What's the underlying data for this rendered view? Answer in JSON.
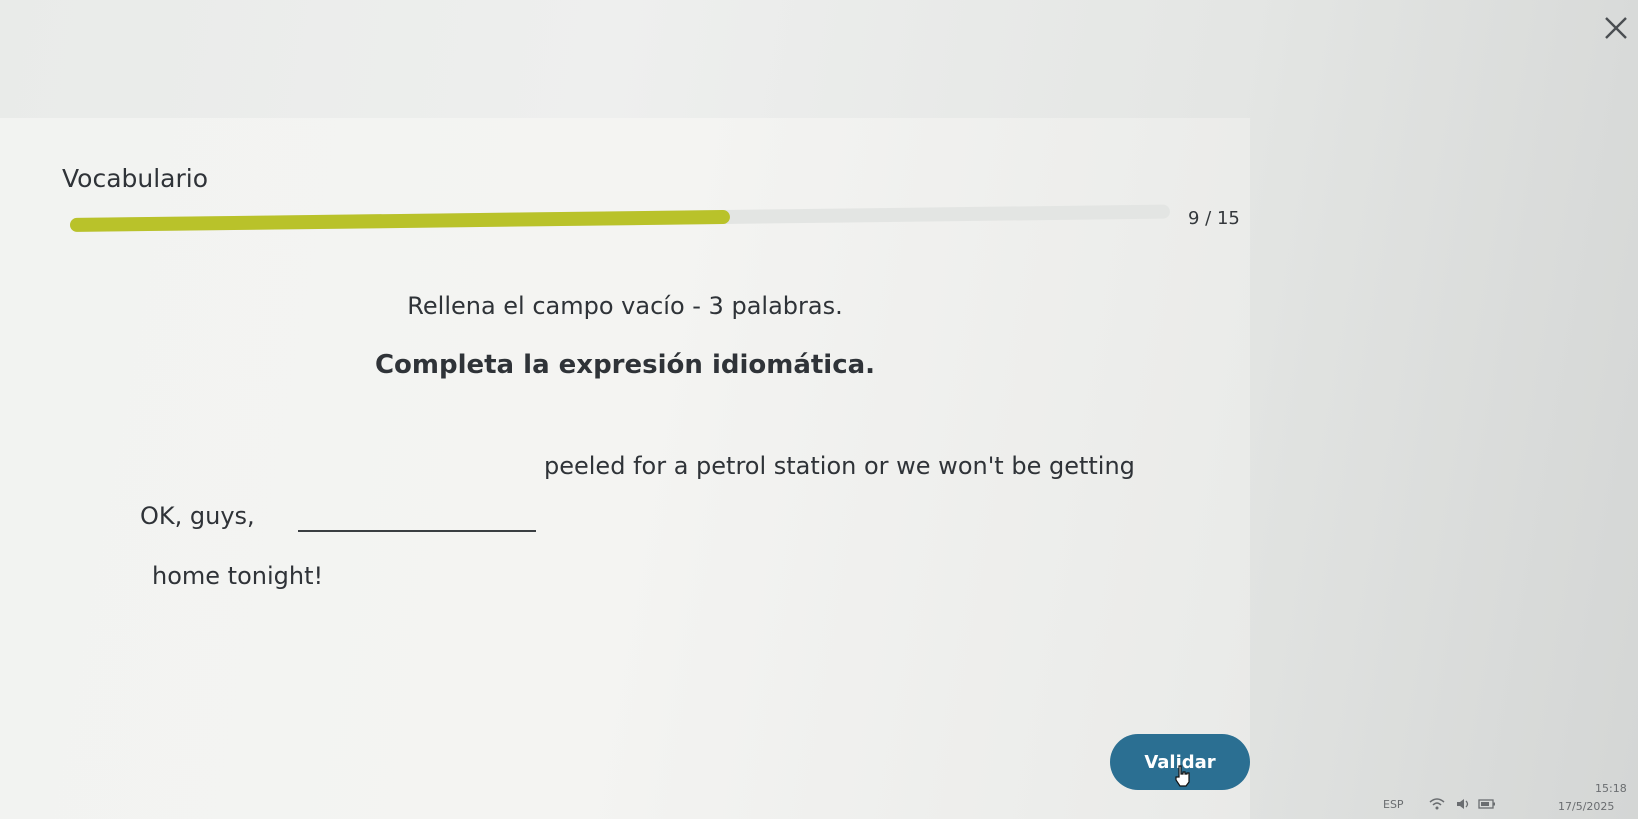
{
  "window": {
    "close_icon": "close-icon"
  },
  "header": {
    "title": "Vocabulario"
  },
  "progress": {
    "current": 9,
    "total": 15,
    "label": "9 / 15",
    "fill_color": "#b9c22a",
    "track_color": "#e3e5e3"
  },
  "exercise": {
    "instruction": "Rellena el campo vacío - 3 palabras.",
    "subtitle": "Completa la expresión idiomática.",
    "sentence_start": "OK, guys,",
    "answer_value": "",
    "sentence_middle": "peeled for a petrol station or we won't be getting",
    "sentence_end": "home tonight!"
  },
  "actions": {
    "validate_label": "Validar",
    "validate_color": "#2b6f92"
  },
  "taskbar": {
    "language": "ESP",
    "time": "15:18",
    "date": "17/5/2025",
    "icons": [
      "wifi-icon",
      "volume-icon",
      "battery-icon"
    ]
  }
}
